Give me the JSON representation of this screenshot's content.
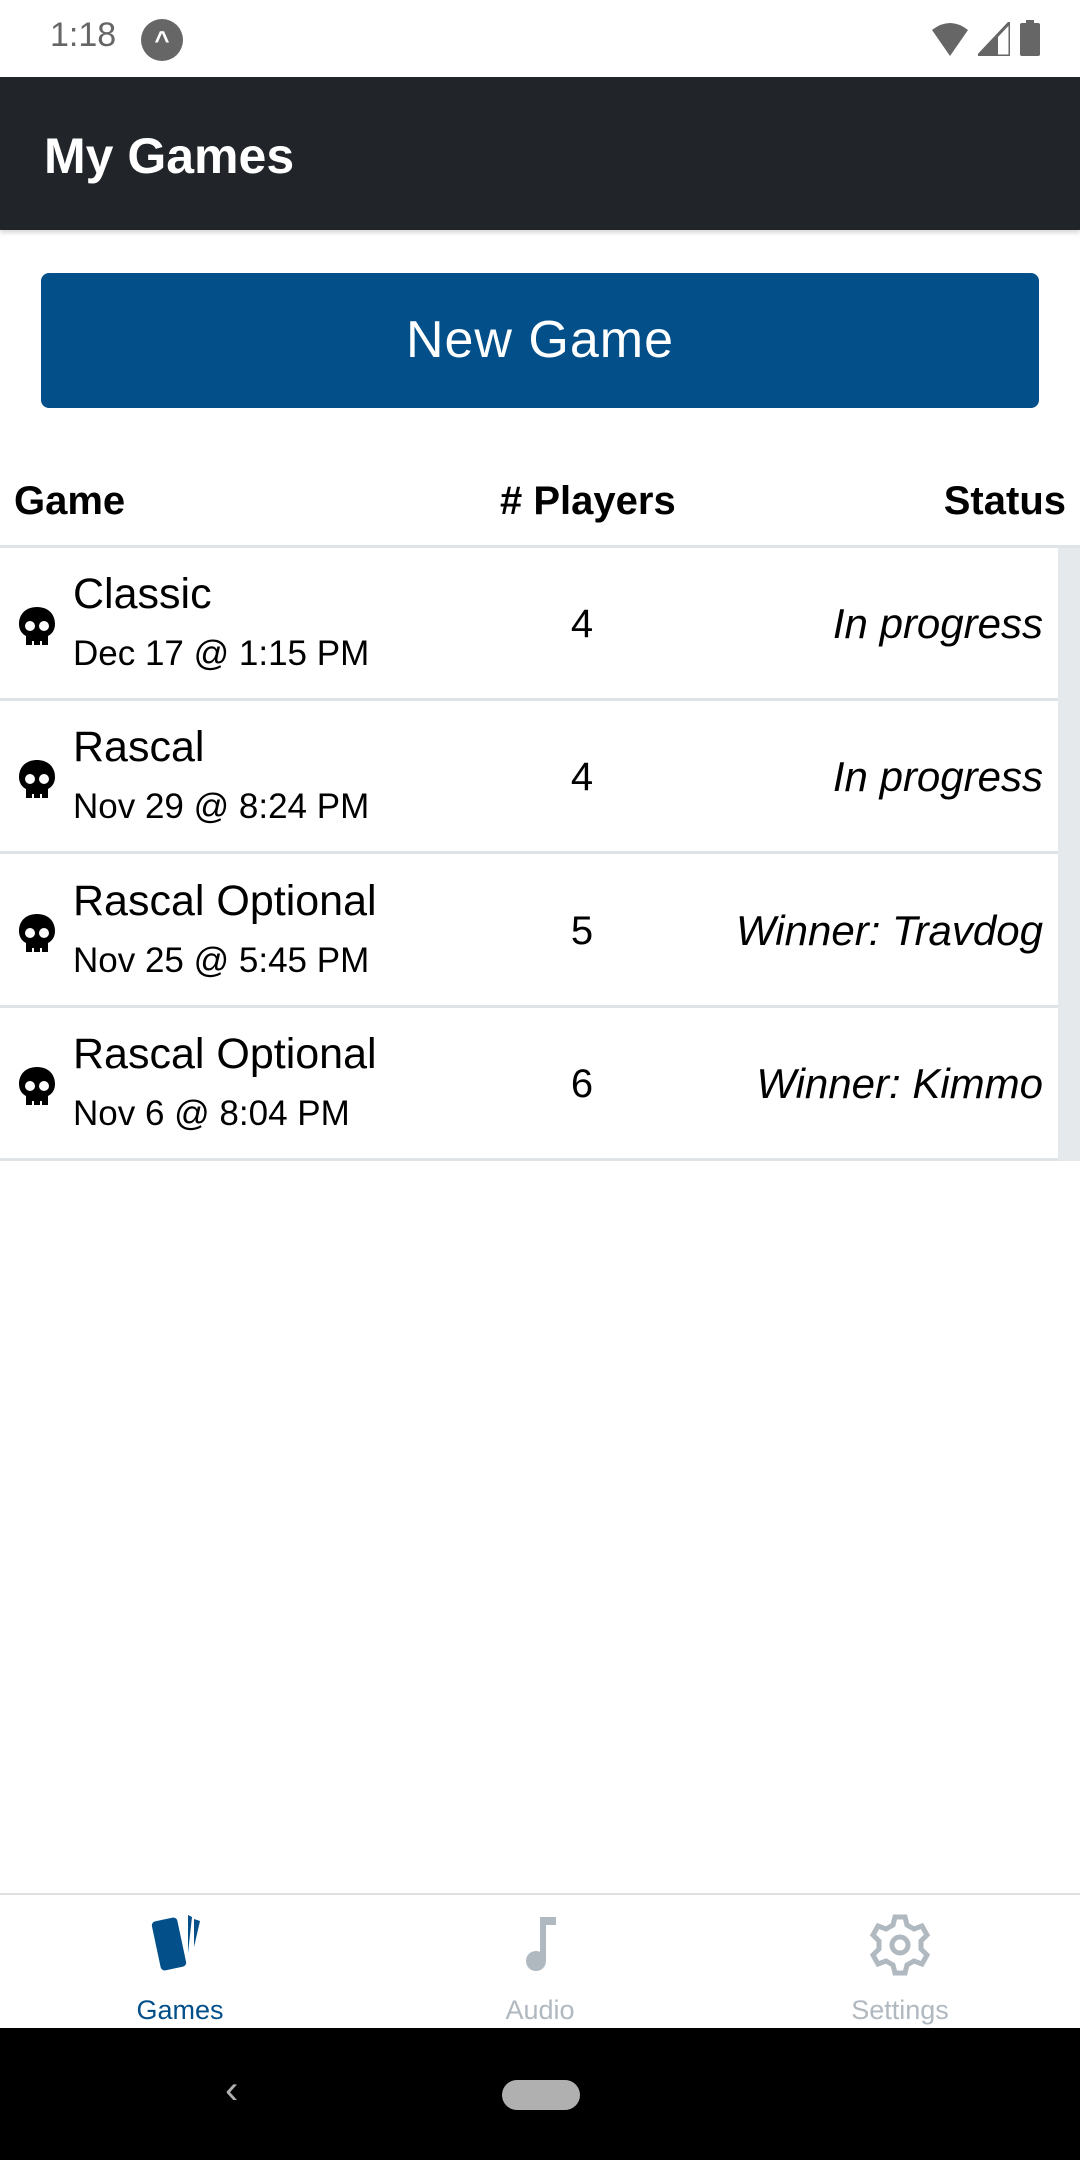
{
  "status_bar": {
    "time": "1:18"
  },
  "header": {
    "title": "My Games"
  },
  "new_game_label": "New Game",
  "table": {
    "columns": [
      "Game",
      "# Players",
      "Status"
    ],
    "rows": [
      {
        "name": "Classic",
        "date": "Dec 17 @ 1:15 PM",
        "players": "4",
        "status": "In progress"
      },
      {
        "name": "Rascal",
        "date": "Nov 29 @ 8:24 PM",
        "players": "4",
        "status": "In progress"
      },
      {
        "name": "Rascal Optional",
        "date": "Nov 25 @ 5:45 PM",
        "players": "5",
        "status": "Winner: Travdog"
      },
      {
        "name": "Rascal Optional",
        "date": "Nov 6 @ 8:04 PM",
        "players": "6",
        "status": "Winner: Kimmo"
      }
    ]
  },
  "bottom_nav": {
    "items": [
      {
        "label": "Games",
        "icon": "cards-icon"
      },
      {
        "label": "Audio",
        "icon": "music-note-icon"
      },
      {
        "label": "Settings",
        "icon": "gear-icon"
      }
    ]
  },
  "colors": {
    "accent": "#024f8a",
    "appbar": "#212429",
    "inactive": "#b0b8c0"
  }
}
